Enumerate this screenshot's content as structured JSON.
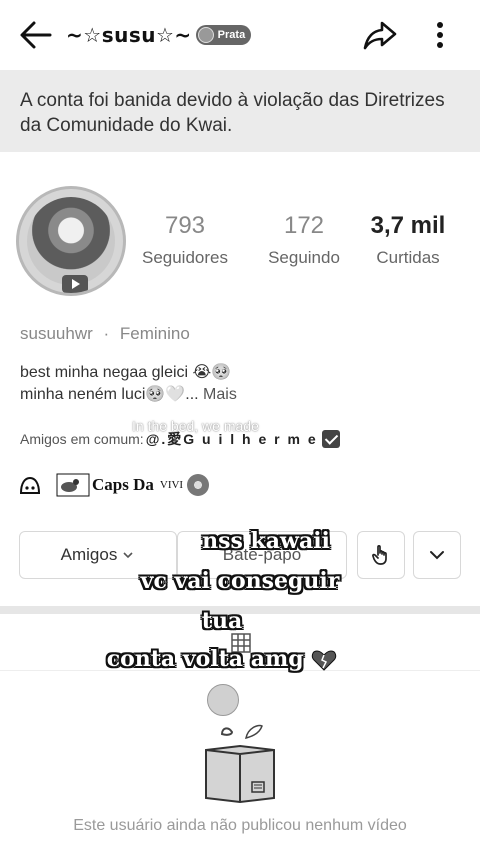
{
  "header": {
    "title": "~☆susu☆~",
    "badge_label": "Prata"
  },
  "banner": {
    "message": "A conta foi banida devido à violação das Diretrizes da Comunidade do Kwai."
  },
  "stats": [
    {
      "value": "793",
      "label": "Seguidores"
    },
    {
      "value": "172",
      "label": "Seguindo"
    },
    {
      "value": "3,7 mil",
      "label": "Curtidas"
    }
  ],
  "profile": {
    "username": "susuuhwr",
    "separator": "·",
    "gender": "Feminino",
    "bio_line1": "best minha negaa gleici 😭🥺",
    "bio_line2": "minha neném luci🥺🤍...",
    "more_label": "Mais",
    "friends_prefix": "Amigos em comum:",
    "friends_name": "@.愛G u i l h e r m e"
  },
  "tags": {
    "group_name": "Caps Da",
    "group_sup": "VIVI"
  },
  "actions": {
    "friends_label": "Amigos",
    "chat_label": "Bate-papo"
  },
  "overlay_text": {
    "faint_line": "In the bed, we made",
    "line1": "nss kawaii",
    "line2": "vc vai conseguir",
    "line3": "tua",
    "line4": "conta volta amg"
  },
  "empty_state": {
    "message": "Este usuário ainda não publicou nenhum vídeo"
  },
  "icons": {
    "back": "arrow-left-icon",
    "share": "share-arrow-icon",
    "more": "vertical-dots-icon",
    "hand": "hand-pointer-icon",
    "chevron": "chevron-down-icon",
    "grid": "grid-icon"
  }
}
